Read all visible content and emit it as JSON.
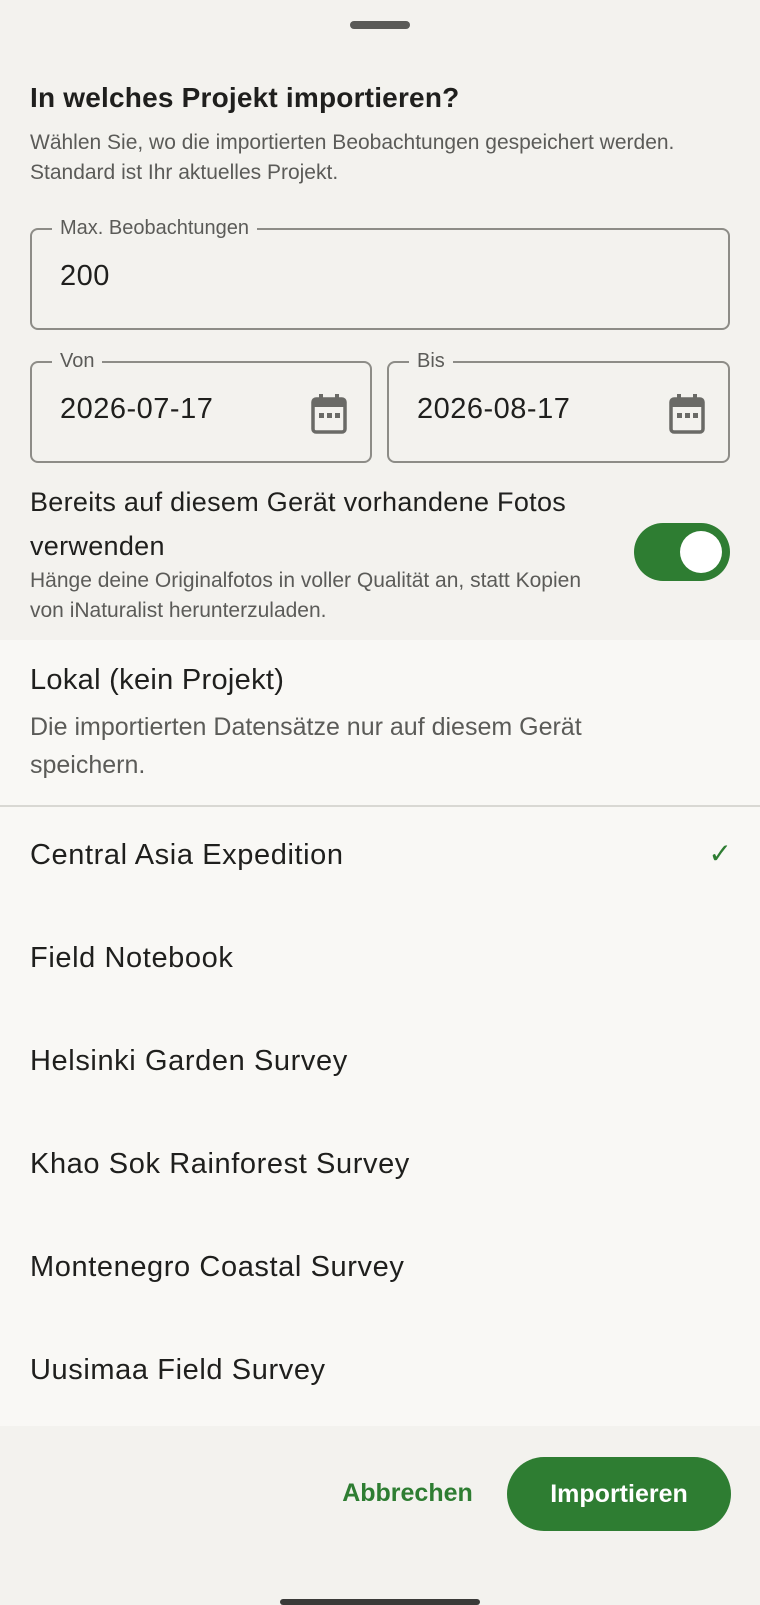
{
  "dialog": {
    "title": "In welches Projekt importieren?",
    "subtitle": "Wählen Sie, wo die importierten Beobachtungen gespeichert werden. Standard ist Ihr aktuelles Projekt."
  },
  "max_obs": {
    "label": "Max. Beobachtungen",
    "value": "200"
  },
  "from_date": {
    "label": "Von",
    "value": "2026-07-17",
    "icon": "calendar-icon"
  },
  "to_date": {
    "label": "Bis",
    "value": "2026-08-17",
    "icon": "calendar-icon"
  },
  "photos_toggle": {
    "title": "Bereits auf diesem Gerät vorhandene Fotos verwenden",
    "description": "Hänge deine Originalfotos in voller Qualität an, statt Kopien von iNaturalist herunterzuladen.",
    "enabled": true
  },
  "local_option": {
    "title": "Lokal (kein Projekt)",
    "description": "Die importierten Datensätze nur auf diesem Gerät speichern."
  },
  "projects": [
    {
      "name": "Central Asia Expedition",
      "selected": true,
      "check": "✓"
    },
    {
      "name": "Field Notebook",
      "selected": false
    },
    {
      "name": "Helsinki Garden Survey",
      "selected": false
    },
    {
      "name": "Khao Sok Rainforest Survey",
      "selected": false
    },
    {
      "name": "Montenegro Coastal Survey",
      "selected": false
    },
    {
      "name": "Uusimaa Field Survey",
      "selected": false
    }
  ],
  "actions": {
    "cancel": "Abbrechen",
    "import": "Importieren"
  },
  "colors": {
    "accent": "#2e7d32",
    "background": "#f3f2ee"
  }
}
